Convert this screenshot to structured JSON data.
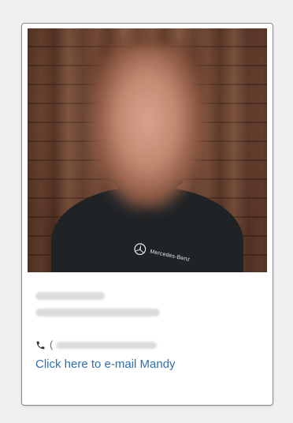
{
  "card": {
    "photo_label": "Mercedes-Benz",
    "phone_prefix": "(",
    "email_link": "Click here to e-mail Mandy"
  },
  "icons": {
    "phone": "phone-icon",
    "brand_logo": "mercedes-star-icon"
  },
  "colors": {
    "link": "#2f6fb0",
    "card_border": "#8c8c8c",
    "background": "#efefef"
  }
}
